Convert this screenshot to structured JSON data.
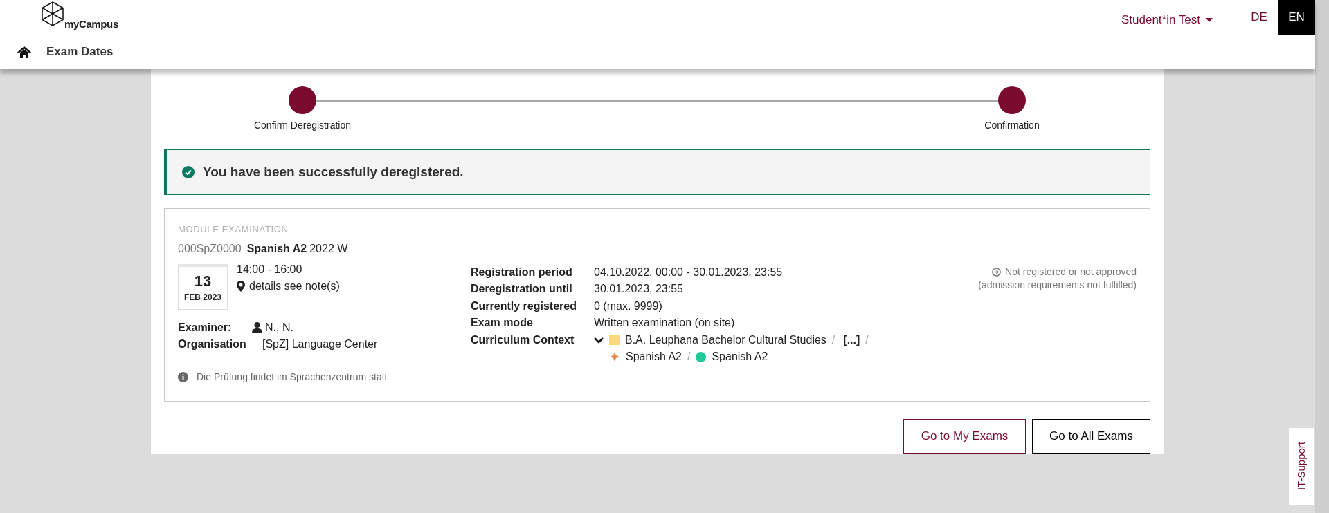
{
  "header": {
    "logo": "myCampus",
    "user_menu": "Student*in Test",
    "languages": [
      {
        "label": "DE",
        "selected": false
      },
      {
        "label": "EN",
        "selected": true
      }
    ],
    "page_title": "Exam Dates"
  },
  "stepper": [
    {
      "label": "Confirm Deregistration",
      "done": true
    },
    {
      "label": "Confirmation",
      "done": true
    }
  ],
  "alert": {
    "message": "You have been successfully deregistered."
  },
  "exam": {
    "category": "MODULE EXAMINATION",
    "code": "000SpZ0000",
    "title": "Spanish A2",
    "term": "2022 W",
    "day": "13",
    "month_year": "FEB 2023",
    "time": "14:00 - 16:00",
    "location": "details see note(s)",
    "examiner_label": "Examiner:",
    "examiner": "N., N.",
    "organisation_label": "Organisation",
    "organisation": "[SpZ] Language Center",
    "details": [
      {
        "label": "Registration period",
        "value": "04.10.2022, 00:00 - 30.01.2023, 23:55"
      },
      {
        "label": "Deregistration until",
        "value": "30.01.2023, 23:55"
      },
      {
        "label": "Currently registered",
        "value": "0 (max. 9999)"
      },
      {
        "label": "Exam mode",
        "value": "Written examination (on site)"
      }
    ],
    "curriculum_label": "Curriculum Context",
    "curriculum": [
      {
        "kind": "square",
        "color": "#fad87c",
        "text": "B.A. Leuphana Bachelor Cultural Studies",
        "separator": "/"
      },
      {
        "kind": "more",
        "text": "[...]",
        "separator": "/"
      },
      {
        "kind": "cross",
        "color": "#e8874a",
        "text": "Spanish A2",
        "separator": "/"
      },
      {
        "kind": "dot",
        "color": "#1fc99a",
        "text": "Spanish A2"
      }
    ],
    "status": "Not registered or not approved",
    "status_note": "(admission requirements not fulfilled)",
    "note": "Die Prüfung findet im Sprachenzentrum statt"
  },
  "buttons": [
    {
      "label": "Go to My Exams",
      "kind": "primary"
    },
    {
      "label": "Go to All Exams",
      "kind": "secondary"
    }
  ],
  "support_tab": "IT-Support"
}
